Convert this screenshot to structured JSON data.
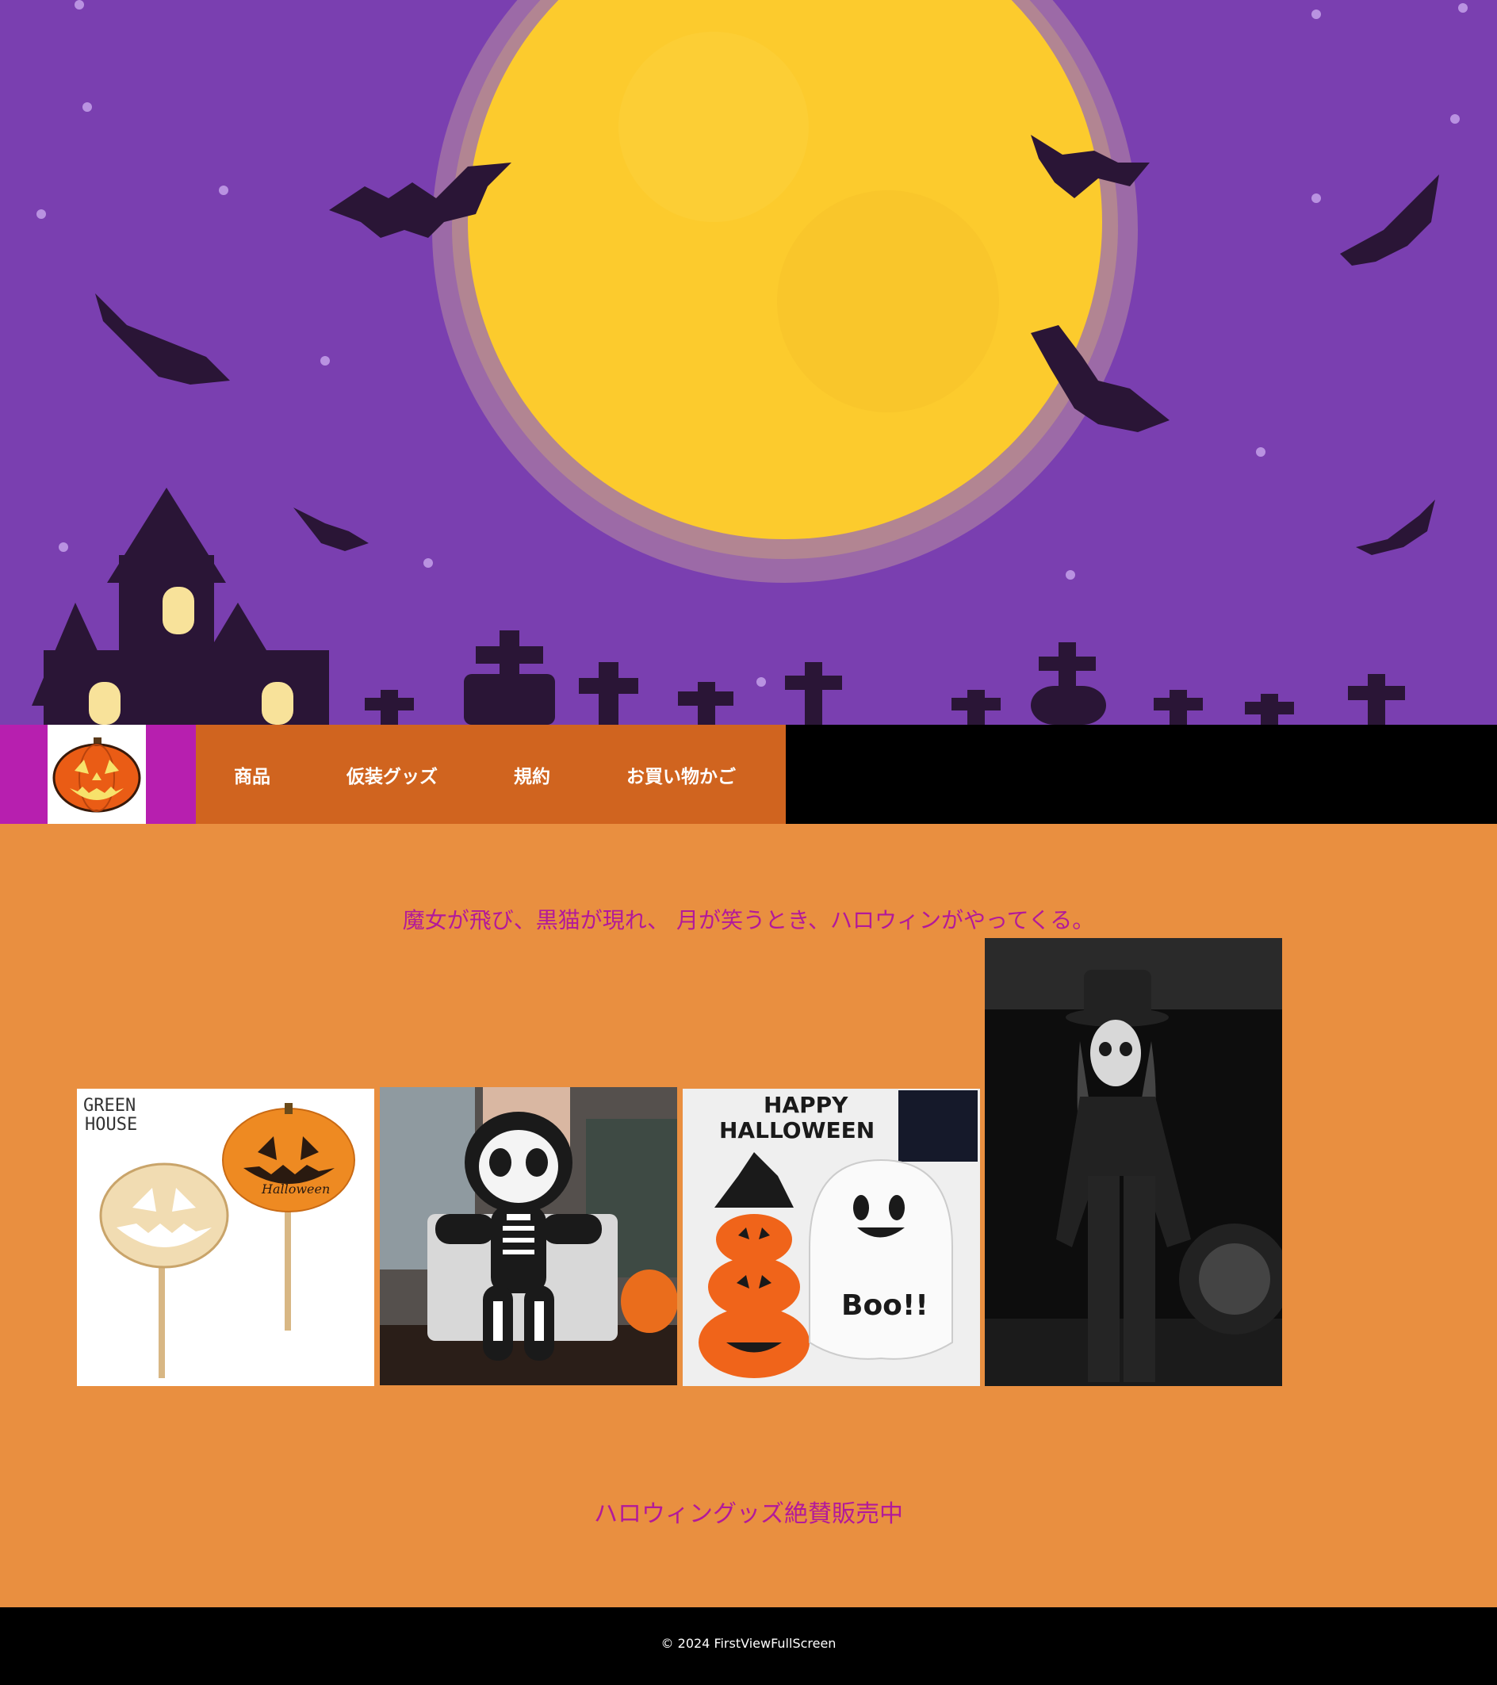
{
  "nav": {
    "logo_icon": "jack-o-lantern-icon",
    "items": [
      {
        "label": "商品"
      },
      {
        "label": "仮装グッズ"
      },
      {
        "label": "規約"
      },
      {
        "label": "お買い物かご"
      }
    ]
  },
  "main": {
    "tagline": "魔女が飛び、黒猫が現れ、 月が笑うとき、ハロウィンがやってくる。",
    "gallery": [
      {
        "name": "pumpkin-picks-image",
        "texts": [
          "GREEN",
          "HOUSE",
          "Halloween"
        ]
      },
      {
        "name": "skeleton-plush-image"
      },
      {
        "name": "inflatable-pumpkin-ghost-image",
        "texts": [
          "HAPPY",
          "HALLOWEEN",
          "Boo!!"
        ]
      },
      {
        "name": "skull-costume-person-image"
      }
    ],
    "sale_text": "ハロウィングッズ絶賛販売中"
  },
  "footer": {
    "copyright": "© 2024 FirstViewFullScreen"
  },
  "colors": {
    "page_bg": "#e98f40",
    "hero_sky": "#7a3fb0",
    "moon": "#fccb2d",
    "logo_bg": "#b71faf",
    "menu_bg": "#d0641f",
    "accent_text": "#b3199a",
    "footer_bg": "#000000"
  }
}
